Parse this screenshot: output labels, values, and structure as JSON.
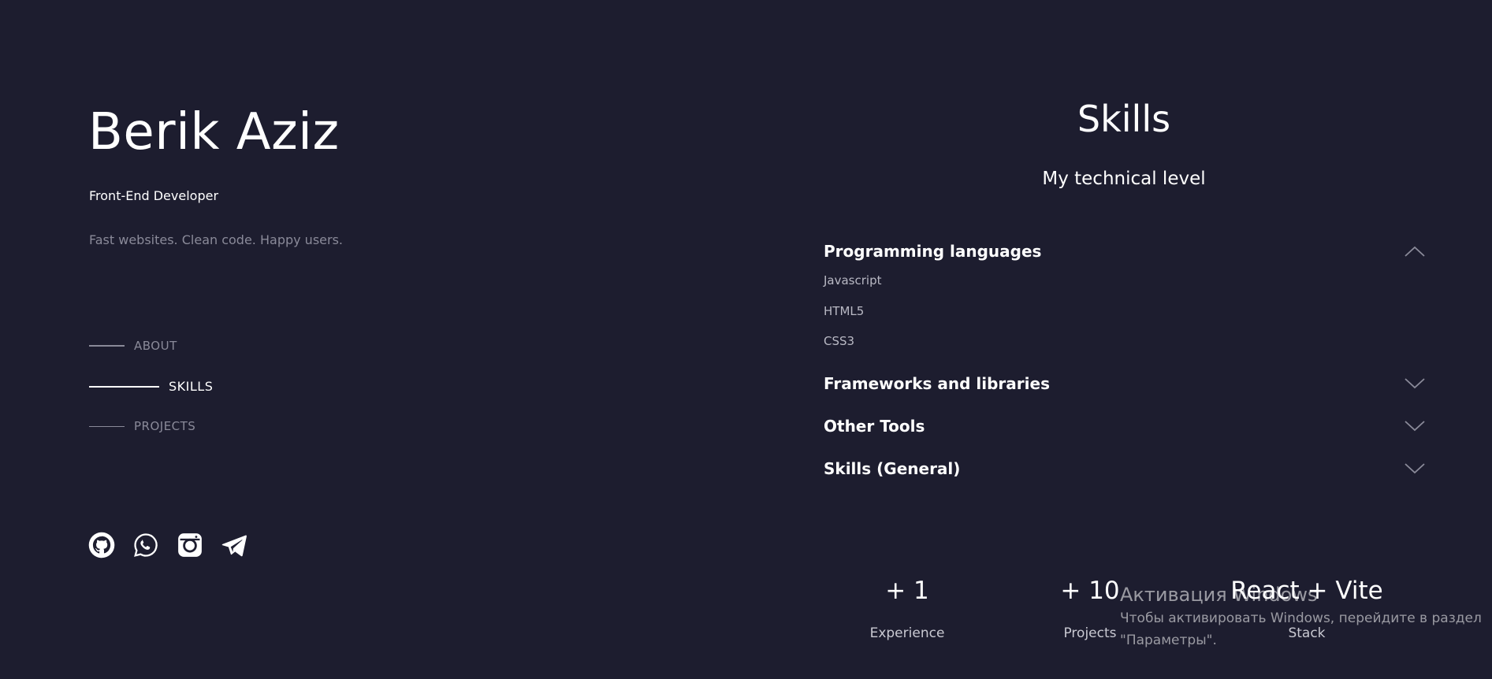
{
  "profile": {
    "name": "Berik Aziz",
    "role": "Front-End Developer",
    "tagline": "Fast websites. Clean code. Happy users."
  },
  "nav": {
    "items": [
      {
        "label": "ABOUT",
        "active": false
      },
      {
        "label": "SKILLS",
        "active": true
      },
      {
        "label": "PROJECTS",
        "active": false
      }
    ]
  },
  "socials": [
    {
      "icon": "github-icon"
    },
    {
      "icon": "whatsapp-icon"
    },
    {
      "icon": "instagram-icon"
    },
    {
      "icon": "telegram-icon"
    }
  ],
  "skills": {
    "title": "Skills",
    "subtitle": "My technical level",
    "groups": [
      {
        "title": "Programming languages",
        "expanded": true,
        "items": [
          "Javascript",
          "HTML5",
          "CSS3"
        ]
      },
      {
        "title": "Frameworks and libraries",
        "expanded": false
      },
      {
        "title": "Other Tools",
        "expanded": false
      },
      {
        "title": "Skills (General)",
        "expanded": false
      }
    ]
  },
  "stats": [
    {
      "value": "+ 1",
      "label": "Experience"
    },
    {
      "value": "+ 10",
      "label": "Projects"
    },
    {
      "value": "React + Vite",
      "label": "Stack"
    }
  ],
  "watermark": {
    "title": "Активация Windows",
    "line1": "Чтобы активировать Windows, перейдите в раздел",
    "line2": "\"Параметры\"."
  },
  "colors": {
    "background": "#1d1d2f",
    "text": "#ffffff",
    "muted": "#8a8a99"
  }
}
